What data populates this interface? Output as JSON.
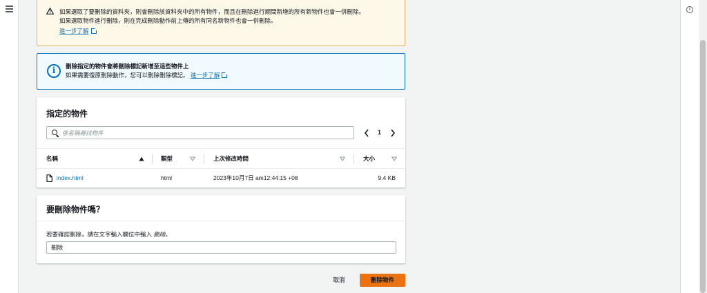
{
  "warning_alert": {
    "line1": "如果選取了要刪除的資料夾，則會刪除該資料夾中的所有物件，而且在刪除進行期間新增的所有新物件也會一併刪除。",
    "line2": "如果選取物件進行刪除，則在完成刪除動作前上傳的所有同名新物件也會一併刪除。",
    "learn_more": "進一步了解"
  },
  "info_alert": {
    "title": "刪除指定的物件會將刪除標記新增至這些物件上",
    "body": "如果需要復原刪除動作，您可以刪除刪除標記。",
    "learn_more": "進一步了解"
  },
  "objects_panel": {
    "title": "指定的物件",
    "search_placeholder": "依名稱尋找物件",
    "page": "1",
    "columns": {
      "name": "名稱",
      "type": "類型",
      "last_modified": "上次修改時間",
      "size": "大小"
    },
    "rows": [
      {
        "name": "index.html",
        "type": "html",
        "last_modified": "2023年10月7日 am12:44:15 +08",
        "size": "9.4 KB"
      }
    ]
  },
  "confirm_panel": {
    "title": "要刪除物件嗎？",
    "hint_prefix": "若要確認刪除，請在文字輸入欄位中輸入 ",
    "hint_keyword": "刪除",
    "hint_suffix": "。",
    "input_value": "刪除"
  },
  "actions": {
    "cancel": "取消",
    "delete": "刪除物件"
  },
  "colors": {
    "primary": "#ec7211",
    "link": "#0073bb",
    "warning_border": "#e5b35d",
    "warning_bg": "#fef8e8",
    "info_bg": "#f1faff"
  },
  "icons": {
    "menu": "hamburger-menu-icon",
    "info": "info-circle-icon",
    "warning": "warning-triangle-icon",
    "external": "external-link-icon",
    "search": "search-icon",
    "file": "file-icon"
  }
}
